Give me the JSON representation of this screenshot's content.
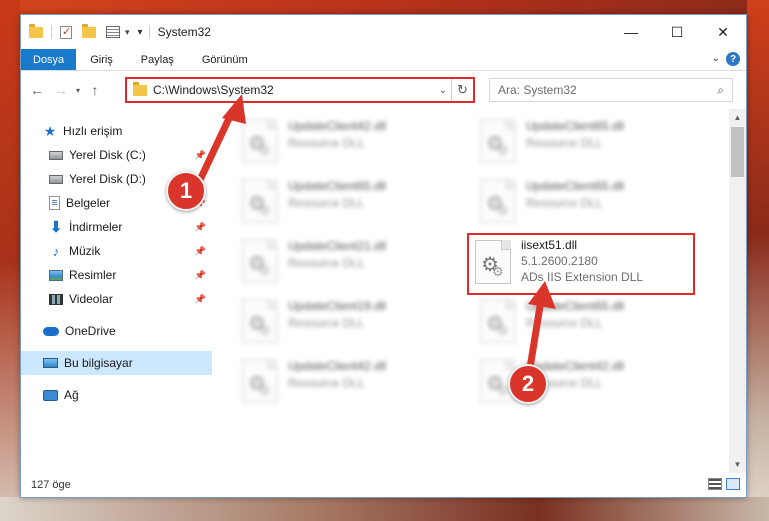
{
  "window": {
    "title": "System32",
    "controls": {
      "minimize": "—",
      "maximize": "☐",
      "close": "✕"
    }
  },
  "ribbon": {
    "tabs": [
      "Dosya",
      "Giriş",
      "Paylaş",
      "Görünüm"
    ]
  },
  "navbar": {
    "address_path": "C:\\Windows\\System32",
    "search_placeholder": "Ara: System32"
  },
  "nav_pane": {
    "quick_access": "Hızlı erişim",
    "items": [
      {
        "label": "Yerel Disk (C:)",
        "icon": "drive-icon",
        "pinned": true
      },
      {
        "label": "Yerel Disk (D:)",
        "icon": "drive-icon",
        "pinned": true
      },
      {
        "label": "Belgeler",
        "icon": "documents-icon",
        "pinned": true
      },
      {
        "label": "İndirmeler",
        "icon": "download-icon",
        "pinned": true
      },
      {
        "label": "Müzik",
        "icon": "music-icon",
        "pinned": true
      },
      {
        "label": "Resimler",
        "icon": "pictures-icon",
        "pinned": true
      },
      {
        "label": "Videolar",
        "icon": "videos-icon",
        "pinned": true
      }
    ],
    "onedrive": "OneDrive",
    "this_pc": "Bu bilgisayar",
    "network": "Ağ"
  },
  "files": {
    "left_column": [
      {
        "name": "UpdateClient42.dll",
        "desc": "Resource DLL"
      },
      {
        "name": "UpdateClient65.dll",
        "desc": "Resource DLL"
      },
      {
        "name": "UpdateClient21.dll",
        "desc": "Resource DLL"
      },
      {
        "name": "UpdateClient19.dll",
        "desc": "Resource DLL"
      },
      {
        "name": "UpdateClient42.dll",
        "desc": "Resource DLL"
      }
    ],
    "right_column": [
      {
        "name": "UpdateClient65.dll",
        "desc": "Resource DLL"
      },
      {
        "name": "UpdateClient65.dll",
        "desc": "Resource DLL"
      },
      {
        "name": "UpdateClient65.dll",
        "desc": "Resource DLL"
      },
      {
        "name": "UpdateClient42.dll",
        "desc": "Resource DLL"
      }
    ],
    "highlighted": {
      "name": "iisext51.dll",
      "version": "5.1.2600.2180",
      "desc": "ADs IIS Extension DLL"
    }
  },
  "status": {
    "item_count": "127 öge"
  },
  "callouts": {
    "one": "1",
    "two": "2"
  },
  "colors": {
    "accent": "#1979ca",
    "highlight_border": "#e02b2b",
    "callout_fill": "#d9352b"
  }
}
